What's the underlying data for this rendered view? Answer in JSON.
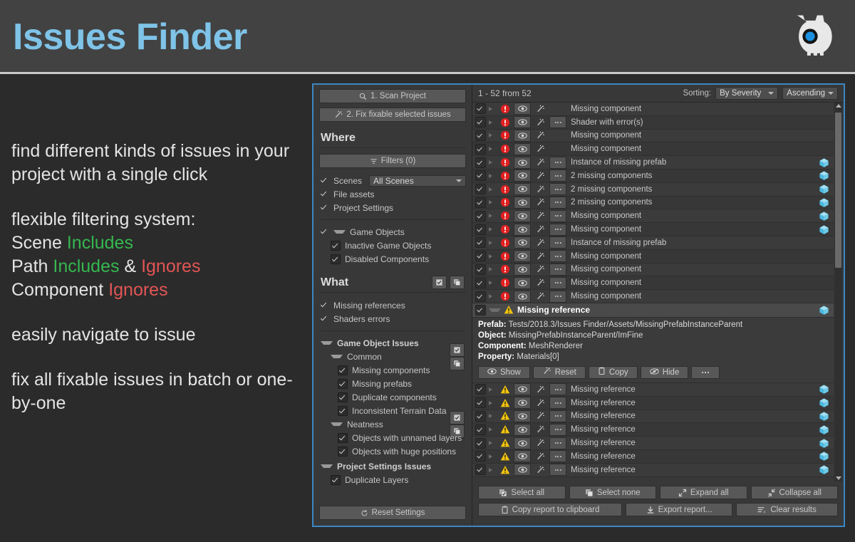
{
  "header": {
    "title": "Issues Finder",
    "logo_icon": "gear-skull-icon"
  },
  "promo": {
    "para1": "find different kinds of issues in your project with a single click",
    "para2_line1": "flexible filtering system:",
    "para2_line2_a": "Scene ",
    "para2_line2_b": "Includes",
    "para2_line3_a": "Path ",
    "para2_line3_b": "Includes",
    "para2_line3_c": " & ",
    "para2_line3_d": "Ignores",
    "para2_line4_a": "Component ",
    "para2_line4_b": "Ignores",
    "para3": "easily navigate to issue",
    "para4": "fix all fixable issues in batch or one-by-one",
    "include_color": "#35b84f",
    "ignore_color": "#e35555"
  },
  "sidebar": {
    "scan_button": "1. Scan Project",
    "fix_button": "2. Fix fixable selected issues",
    "where_heading": "Where",
    "filters_button": "Filters (0)",
    "scenes_label": "Scenes",
    "scenes_dropdown_value": "All Scenes",
    "file_assets_label": "File assets",
    "project_settings_label": "Project Settings",
    "game_objects_label": "Game Objects",
    "inactive_game_objects_label": "Inactive Game Objects",
    "disabled_components_label": "Disabled Components",
    "what_heading": "What",
    "missing_references_label": "Missing references",
    "shaders_errors_label": "Shaders errors",
    "game_object_issues_label": "Game Object Issues",
    "common_label": "Common",
    "common_items": [
      "Missing components",
      "Missing prefabs",
      "Duplicate components",
      "Inconsistent Terrain Data"
    ],
    "neatness_label": "Neatness",
    "neatness_items": [
      "Objects with unnamed layers",
      "Objects with huge positions"
    ],
    "project_settings_issues_label": "Project Settings Issues",
    "duplicate_layers_label": "Duplicate Layers",
    "reset_settings_button": "Reset Settings"
  },
  "results": {
    "count_text": "1 - 52 from 52",
    "sorting_label": "Sorting:",
    "sort_by_value": "By Severity",
    "sort_order_value": "Ascending",
    "rows": [
      {
        "severity": "error",
        "label": "Missing component",
        "dots": false,
        "cube": false
      },
      {
        "severity": "error",
        "label": "Shader with error(s)",
        "dots": true,
        "cube": false
      },
      {
        "severity": "error",
        "label": "Missing component",
        "dots": false,
        "cube": false
      },
      {
        "severity": "error",
        "label": "Missing component",
        "dots": false,
        "cube": false
      },
      {
        "severity": "error",
        "label": "Instance of missing prefab",
        "dots": true,
        "cube": true
      },
      {
        "severity": "error",
        "label": "2 missing components",
        "dots": true,
        "cube": true
      },
      {
        "severity": "error",
        "label": "2 missing components",
        "dots": true,
        "cube": true
      },
      {
        "severity": "error",
        "label": "2 missing components",
        "dots": true,
        "cube": true
      },
      {
        "severity": "error",
        "label": "Missing component",
        "dots": true,
        "cube": true
      },
      {
        "severity": "error",
        "label": "Missing component",
        "dots": true,
        "cube": true
      },
      {
        "severity": "error",
        "label": "Instance of missing prefab",
        "dots": true,
        "cube": false
      },
      {
        "severity": "error",
        "label": "Missing component",
        "dots": true,
        "cube": false
      },
      {
        "severity": "error",
        "label": "Missing component",
        "dots": true,
        "cube": false
      },
      {
        "severity": "error",
        "label": "Missing component",
        "dots": true,
        "cube": false
      },
      {
        "severity": "error",
        "label": "Missing component",
        "dots": true,
        "cube": false
      }
    ],
    "selected_row": {
      "severity": "warning",
      "label": "Missing reference",
      "cube": true
    },
    "detail": {
      "prefab_key": "Prefab:",
      "prefab_value": " Tests/2018.3/Issues Finder/Assets/MissingPrefabInstanceParent",
      "object_key": "Object:",
      "object_value": " MissingPrefabInstanceParent/ImFine",
      "component_key": "Component:",
      "component_value": " MeshRenderer",
      "property_key": "Property:",
      "property_value": " Materials[0]",
      "buttons": [
        {
          "label": "Show",
          "icon": "eye-icon"
        },
        {
          "label": "Reset",
          "icon": "wand-icon"
        },
        {
          "label": "Copy",
          "icon": "clipboard-icon"
        },
        {
          "label": "Hide",
          "icon": "eye-off-icon"
        },
        {
          "label": "",
          "icon": "ellipsis-icon"
        }
      ]
    },
    "rows_after": [
      {
        "severity": "warning",
        "label": "Missing reference",
        "dots": true,
        "cube": true
      },
      {
        "severity": "warning",
        "label": "Missing reference",
        "dots": true,
        "cube": true
      },
      {
        "severity": "warning",
        "label": "Missing reference",
        "dots": true,
        "cube": true
      },
      {
        "severity": "warning",
        "label": "Missing reference",
        "dots": true,
        "cube": true
      },
      {
        "severity": "warning",
        "label": "Missing reference",
        "dots": true,
        "cube": true
      },
      {
        "severity": "warning",
        "label": "Missing reference",
        "dots": true,
        "cube": true
      },
      {
        "severity": "warning",
        "label": "Missing reference",
        "dots": true,
        "cube": true
      }
    ],
    "footer_row1": [
      {
        "label": "Select all",
        "icon": "select-all-icon"
      },
      {
        "label": "Select none",
        "icon": "select-none-icon"
      },
      {
        "label": "Expand all",
        "icon": "expand-icon"
      },
      {
        "label": "Collapse all",
        "icon": "collapse-icon"
      }
    ],
    "footer_row2": [
      {
        "label": "Copy report to clipboard",
        "icon": "clipboard-icon"
      },
      {
        "label": "Export report...",
        "icon": "download-icon"
      },
      {
        "label": "Clear results",
        "icon": "clear-icon"
      }
    ]
  },
  "colors": {
    "accent_blue": "#7fc3e8",
    "panel_border": "#3b87c4",
    "error_red": "#e02020",
    "warning_yellow": "#f1c40f",
    "cube_blue": "#5ec8ee"
  }
}
